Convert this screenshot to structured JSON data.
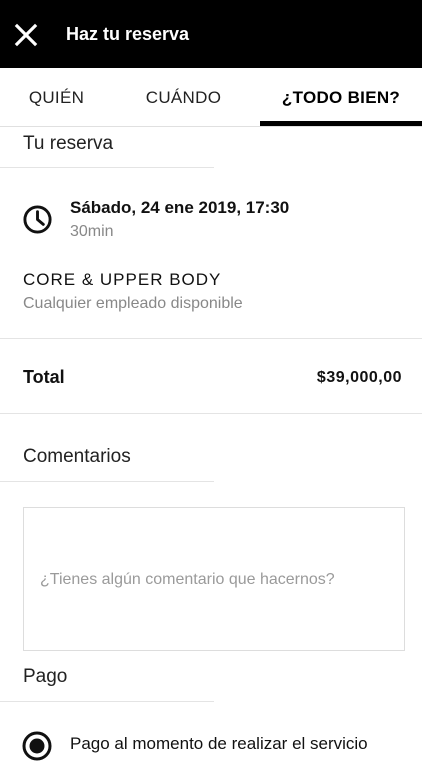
{
  "header": {
    "title": "Haz tu reserva",
    "close_icon": "close-icon"
  },
  "tabs": [
    {
      "label": "QUIÉN",
      "active": false
    },
    {
      "label": "CUÁNDO",
      "active": false
    },
    {
      "label": "¿TODO BIEN?",
      "active": true
    }
  ],
  "reservation": {
    "section_title": "Tu reserva",
    "datetime": "Sábado, 24 ene 2019, 17:30",
    "duration": "30min",
    "service_name": "CORE & UPPER BODY",
    "employee": "Cualquier empleado disponible",
    "clock_icon": "clock-icon"
  },
  "total": {
    "label": "Total",
    "value": "$39,000,00"
  },
  "comments": {
    "section_title": "Comentarios",
    "value": "",
    "placeholder": "¿Tienes algún comentario que hacernos?"
  },
  "payment": {
    "section_title": "Pago",
    "option_label": "Pago al momento de realizar el servicio",
    "selected": true
  },
  "colors": {
    "header_bg": "#000000",
    "header_text": "#ffffff",
    "active_tab_indicator": "#000000",
    "muted_text": "#888888"
  }
}
